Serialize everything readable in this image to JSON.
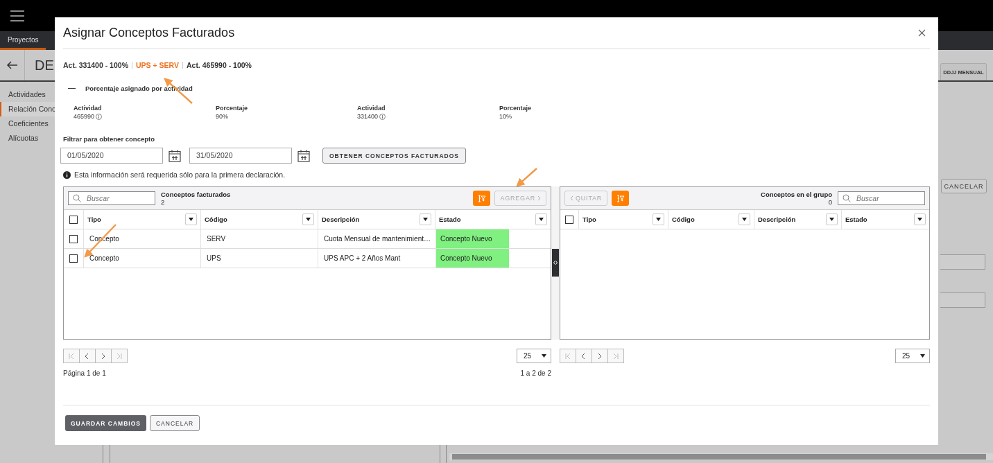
{
  "app": {
    "nav_tab": {
      "label": "Proyectos",
      "selected": true
    },
    "page_title": "DE",
    "sidebar": [
      {
        "label": "Actividades",
        "selected": false
      },
      {
        "label": "Relación Conc",
        "selected": true
      },
      {
        "label": "Coeficientes",
        "selected": false
      },
      {
        "label": "Alícuotas",
        "selected": false
      }
    ],
    "right_tab": "DDJJ MENSUAL",
    "right_button": "CANCELAR"
  },
  "dialog": {
    "title": "Asignar Conceptos Facturados",
    "breadcrumb": [
      {
        "label": "Act. 331400 - 100%",
        "selected": false
      },
      {
        "label": "UPS + SERV",
        "selected": true
      },
      {
        "label": "Act. 465990 - 100%",
        "selected": false
      }
    ],
    "section": {
      "title": "Porcentaje asignado por actividad",
      "expanded": true,
      "items": [
        {
          "activity_label": "Actividad",
          "activity": "465990",
          "percent_label": "Porcentaje",
          "percent": "90%"
        },
        {
          "activity_label": "Actividad",
          "activity": "331400",
          "percent_label": "Porcentaje",
          "percent": "10%"
        }
      ]
    },
    "filter": {
      "label": "Filtrar para obtener concepto",
      "from": "01/05/2020",
      "to": "31/05/2020",
      "button": "OBTENER CONCEPTOS FACTURADOS",
      "note": "Esta información será requerida sólo para la primera declaración."
    },
    "left_grid": {
      "search_placeholder": "Buscar",
      "title": "Conceptos facturados",
      "count": "2",
      "action": {
        "label": "AGREGAR",
        "disabled": true
      },
      "columns": [
        "Tipo",
        "Código",
        "Descripción",
        "Estado"
      ],
      "all_checked": false,
      "rows": [
        {
          "checked": false,
          "cells": [
            "Concepto",
            "SERV",
            "Cuota Mensual de mantenimient…",
            "Concepto Nuevo"
          ]
        },
        {
          "checked": false,
          "cells": [
            "Concepto",
            "UPS",
            "UPS APC + 2 Años Mant",
            "Concepto Nuevo"
          ]
        }
      ],
      "pager": [
        {
          "kind": "first",
          "disabled": true
        },
        {
          "kind": "prev",
          "disabled": false
        },
        {
          "kind": "next",
          "disabled": false
        },
        {
          "kind": "last",
          "disabled": true
        }
      ],
      "page_size": "25",
      "page_info": "Página 1 de 1",
      "range": "1 a 2 de 2"
    },
    "right_grid": {
      "action": {
        "label": "QUITAR",
        "disabled": true
      },
      "title": "Conceptos en el grupo",
      "count": "0",
      "search_placeholder": "Buscar",
      "columns": [
        "Tipo",
        "Código",
        "Descripción",
        "Estado"
      ],
      "all_checked": false,
      "pager": [
        {
          "kind": "first",
          "disabled": true
        },
        {
          "kind": "prev",
          "disabled": false
        },
        {
          "kind": "next",
          "disabled": false
        },
        {
          "kind": "last",
          "disabled": true
        }
      ],
      "page_size": "25"
    },
    "footer": {
      "save": "GUARDAR CAMBIOS",
      "cancel": "CANCELAR"
    }
  }
}
